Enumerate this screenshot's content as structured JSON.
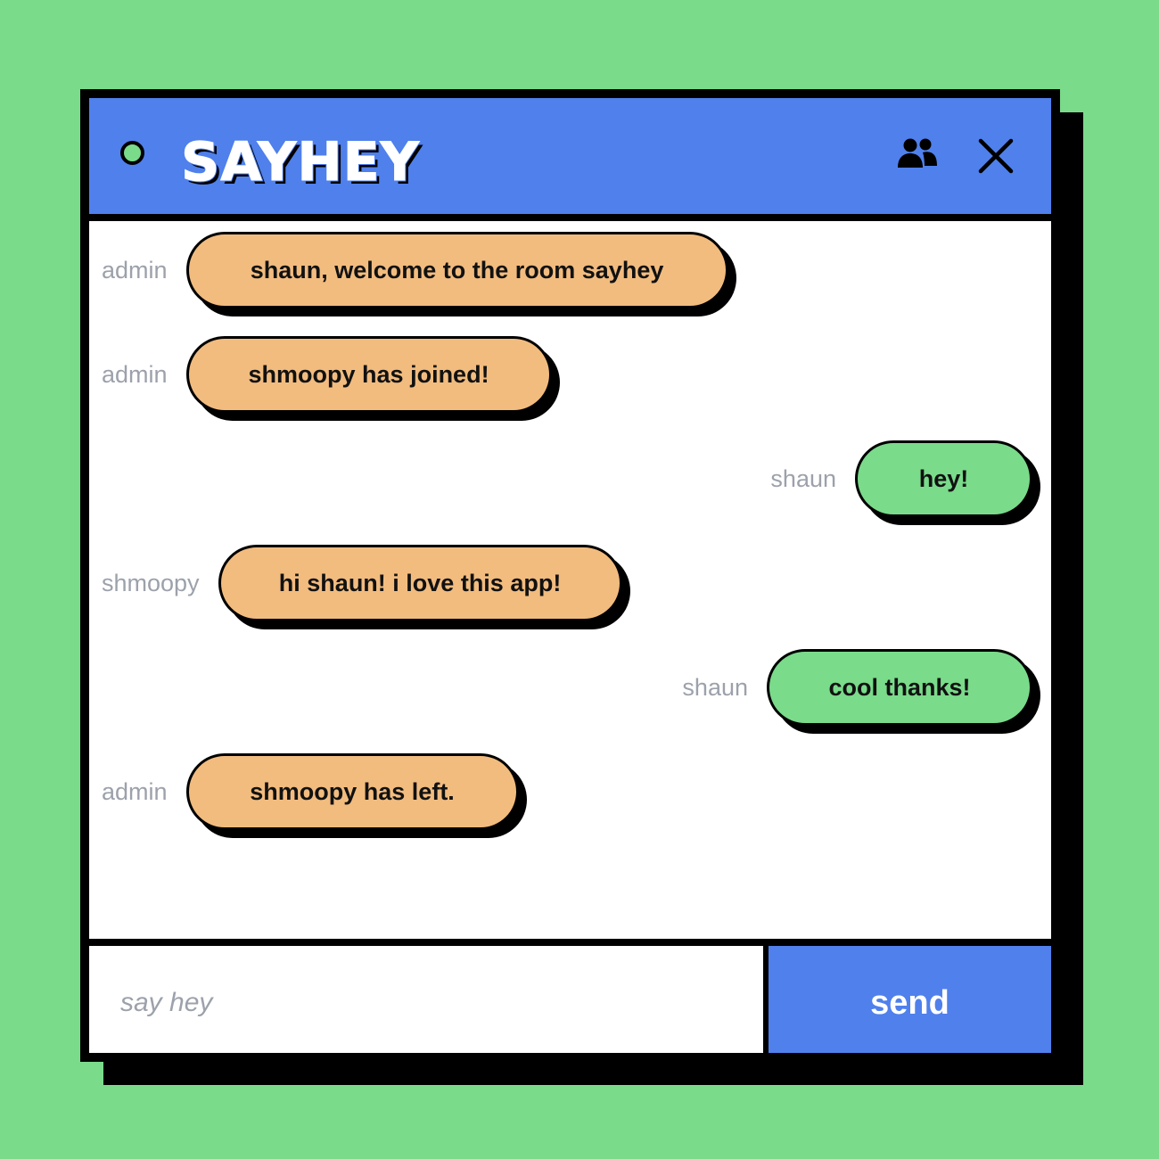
{
  "app": {
    "title": "SAYHEY"
  },
  "colors": {
    "background": "#7adb8b",
    "header": "#4f80ec",
    "incoming_bubble": "#f2bc7f",
    "outgoing_bubble": "#7adb8b",
    "sender_label": "#9ca1ab",
    "send_button": "#4f80ec"
  },
  "header": {
    "status_icon": "online-dot-icon",
    "users_icon": "users-icon",
    "close_icon": "close-icon"
  },
  "messages": [
    {
      "sender": "admin",
      "text": "shaun, welcome to the room sayhey",
      "own": false
    },
    {
      "sender": "admin",
      "text": "shmoopy has joined!",
      "own": false
    },
    {
      "sender": "shaun",
      "text": "hey!",
      "own": true
    },
    {
      "sender": "shmoopy",
      "text": "hi shaun! i love this app!",
      "own": false
    },
    {
      "sender": "shaun",
      "text": "cool thanks!",
      "own": true
    },
    {
      "sender": "admin",
      "text": "shmoopy has left.",
      "own": false
    }
  ],
  "composer": {
    "placeholder": "say hey",
    "value": "",
    "send_label": "send"
  }
}
